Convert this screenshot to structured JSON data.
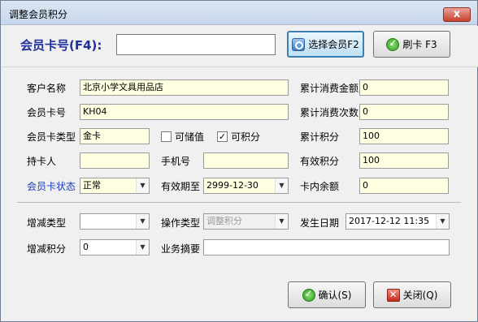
{
  "window": {
    "title": "调整会员积分",
    "close_glyph": "x"
  },
  "card_search": {
    "label": "会员卡号(F4):",
    "value": "",
    "select_button": "选择会员F2",
    "swipe_button": "刷卡 F3"
  },
  "info": {
    "customer_name_label": "客户名称",
    "customer_name": "北京小学文具用品店",
    "card_no_label": "会员卡号",
    "card_no": "KH04",
    "card_type_label": "会员卡类型",
    "card_type": "金卡",
    "stored_value_label": "可储值",
    "stored_value_checked": false,
    "points_enabled_label": "可积分",
    "points_enabled_checked": true,
    "holder_label": "持卡人",
    "holder": "",
    "phone_label": "手机号",
    "phone": "",
    "status_label": "会员卡状态",
    "status": "正常",
    "expiry_label": "有效期至",
    "expiry": "2999-12-30",
    "total_spent_label": "累计消费金额",
    "total_spent": "0",
    "spend_count_label": "累计消费次数",
    "spend_count": "0",
    "total_points_label": "累计积分",
    "total_points": "100",
    "valid_points_label": "有效积分",
    "valid_points": "100",
    "balance_label": "卡内余额",
    "balance": "0"
  },
  "adjust": {
    "type_label": "增减类型",
    "type": "",
    "op_type_label": "操作类型",
    "op_type": "调整积分",
    "date_label": "发生日期",
    "date": "2017-12-12 11:35",
    "points_label": "增减积分",
    "points": "0",
    "summary_label": "业务摘要",
    "summary": ""
  },
  "actions": {
    "confirm": "确认(S)",
    "close": "关闭(Q)"
  }
}
